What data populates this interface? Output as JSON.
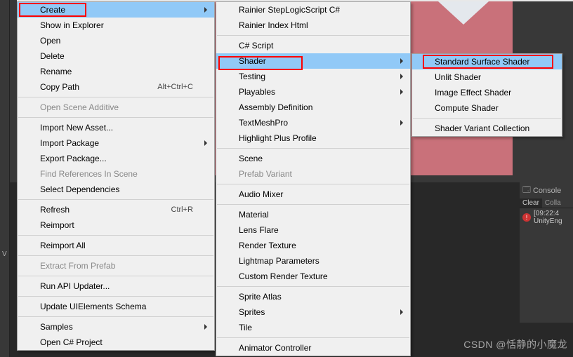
{
  "menu1": [
    {
      "label": "Create",
      "arrow": true,
      "hl": true
    },
    {
      "label": "Show in Explorer"
    },
    {
      "label": "Open"
    },
    {
      "label": "Delete"
    },
    {
      "label": "Rename"
    },
    {
      "label": "Copy Path",
      "shortcut": "Alt+Ctrl+C"
    },
    {
      "sep": true
    },
    {
      "label": "Open Scene Additive",
      "disabled": true
    },
    {
      "sep": true
    },
    {
      "label": "Import New Asset..."
    },
    {
      "label": "Import Package",
      "arrow": true
    },
    {
      "label": "Export Package..."
    },
    {
      "label": "Find References In Scene",
      "disabled": true
    },
    {
      "label": "Select Dependencies"
    },
    {
      "sep": true
    },
    {
      "label": "Refresh",
      "shortcut": "Ctrl+R"
    },
    {
      "label": "Reimport"
    },
    {
      "sep": true
    },
    {
      "label": "Reimport All"
    },
    {
      "sep": true
    },
    {
      "label": "Extract From Prefab",
      "disabled": true
    },
    {
      "sep": true
    },
    {
      "label": "Run API Updater..."
    },
    {
      "sep": true
    },
    {
      "label": "Update UIElements Schema"
    },
    {
      "sep": true
    },
    {
      "label": "Samples",
      "arrow": true
    },
    {
      "label": "Open C# Project"
    }
  ],
  "menu2": [
    {
      "label": "Rainier StepLogicScript C#"
    },
    {
      "label": "Rainier Index Html"
    },
    {
      "sep": true
    },
    {
      "label": "C# Script"
    },
    {
      "label": "Shader",
      "arrow": true,
      "hl": true
    },
    {
      "label": "Testing",
      "arrow": true
    },
    {
      "label": "Playables",
      "arrow": true
    },
    {
      "label": "Assembly Definition"
    },
    {
      "label": "TextMeshPro",
      "arrow": true
    },
    {
      "label": "Highlight Plus Profile"
    },
    {
      "sep": true
    },
    {
      "label": "Scene"
    },
    {
      "label": "Prefab Variant",
      "disabled": true
    },
    {
      "sep": true
    },
    {
      "label": "Audio Mixer"
    },
    {
      "sep": true
    },
    {
      "label": "Material"
    },
    {
      "label": "Lens Flare"
    },
    {
      "label": "Render Texture"
    },
    {
      "label": "Lightmap Parameters"
    },
    {
      "label": "Custom Render Texture"
    },
    {
      "sep": true
    },
    {
      "label": "Sprite Atlas"
    },
    {
      "label": "Sprites",
      "arrow": true
    },
    {
      "label": "Tile"
    },
    {
      "sep": true
    },
    {
      "label": "Animator Controller"
    }
  ],
  "menu3": [
    {
      "label": "Standard Surface Shader",
      "hl": true
    },
    {
      "label": "Unlit Shader"
    },
    {
      "label": "Image Effect Shader"
    },
    {
      "label": "Compute Shader"
    },
    {
      "sep": true
    },
    {
      "label": "Shader Variant Collection"
    }
  ],
  "console": {
    "title": "Console",
    "tabs": [
      "Clear",
      "Colla"
    ],
    "row_time": "[09:22:4",
    "row_text": "UnityEng"
  },
  "left_labels": [
    "V"
  ],
  "watermark": "CSDN @恬静的小魔龙"
}
